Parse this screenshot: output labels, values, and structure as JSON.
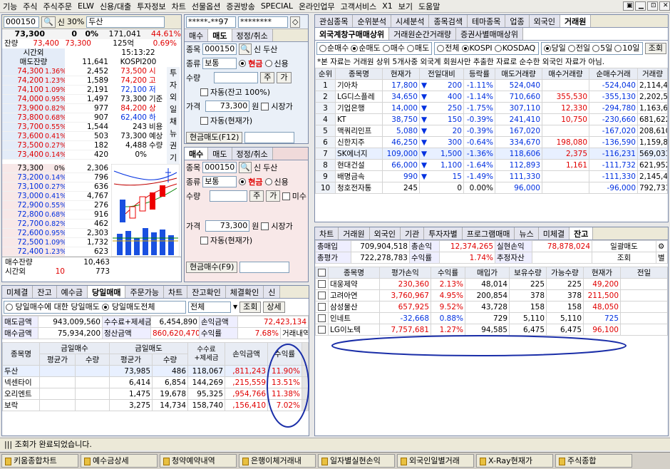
{
  "menu": [
    "기능",
    "주식",
    "주식주문",
    "ELW",
    "신용/대출",
    "투자정보",
    "차트",
    "선물옵션",
    "증권방송",
    "SPECIAL",
    "온라인업무",
    "고객서비스",
    "X1",
    "보기",
    "도움말"
  ],
  "window_buttons": [
    "▣",
    "▁",
    "⊡",
    "✕"
  ],
  "quote": {
    "code": "000150",
    "margin_tag": "신",
    "margin_pct": "30%",
    "name": "두산",
    "price": "73,300",
    "change": "0",
    "change_pct": "0%",
    "volume": "171,041",
    "turnover": "44.61%",
    "label_balance": "잔량",
    "hi1": "73,400",
    "hi2": "73,300",
    "vol_ratio": "125억",
    "pct2": "0.69%",
    "time_label": "시간외",
    "time_label2": "매도잔량",
    "time_val": "11,641",
    "clock": "15:13:22",
    "index_name": "KOSPI200",
    "ask": [
      {
        "price": "74,300",
        "pct": "1.36%",
        "vol": "2,452"
      },
      {
        "price": "74,200",
        "pct": "1.23%",
        "vol": "1,589"
      },
      {
        "price": "74,100",
        "pct": "1.09%",
        "vol": "2,191"
      },
      {
        "price": "74,000",
        "pct": "0.95%",
        "vol": "1,497"
      },
      {
        "price": "73,900",
        "pct": "0.82%",
        "vol": "977"
      },
      {
        "price": "73,800",
        "pct": "0.68%",
        "vol": "907"
      },
      {
        "price": "73,700",
        "pct": "0.55%",
        "vol": "1,544"
      },
      {
        "price": "73,600",
        "pct": "0.41%",
        "vol": "503"
      },
      {
        "price": "73,500",
        "pct": "0.27%",
        "vol": "182"
      },
      {
        "price": "73,400",
        "pct": "0.14%",
        "vol": "420"
      }
    ],
    "bid": [
      {
        "price": "73,300",
        "pct": "0%",
        "vol": "2,306"
      },
      {
        "price": "73,200",
        "pct": "0.14%",
        "vol": "796"
      },
      {
        "price": "73,100",
        "pct": "0.27%",
        "vol": "636"
      },
      {
        "price": "73,000",
        "pct": "0.41%",
        "vol": "4,767"
      },
      {
        "price": "72,900",
        "pct": "0.55%",
        "vol": "276"
      },
      {
        "price": "72,800",
        "pct": "0.68%",
        "vol": "916"
      },
      {
        "price": "72,700",
        "pct": "0.82%",
        "vol": "462"
      },
      {
        "price": "72,600",
        "pct": "0.95%",
        "vol": "2,303"
      },
      {
        "price": "72,500",
        "pct": "1.09%",
        "vol": "1,732"
      },
      {
        "price": "72,400",
        "pct": "1.23%",
        "vol": "623"
      }
    ],
    "info": [
      {
        "v": "73,500",
        "l": "시"
      },
      {
        "v": "74,200",
        "l": "고"
      },
      {
        "v": "72,100",
        "l": "저"
      },
      {
        "v": "73,300",
        "l": "기준"
      },
      {
        "v": "84,200",
        "l": "상"
      },
      {
        "v": "62,400",
        "l": "하"
      },
      {
        "v": "243",
        "l": "비용"
      },
      {
        "v": "73,300",
        "l": "예상"
      },
      {
        "v": "4,488",
        "l": "수량"
      },
      {
        "v": "0%",
        "l": ""
      }
    ],
    "side_letters": [
      "투",
      "자",
      "외",
      "일",
      "채",
      "뉴",
      "권",
      "기"
    ],
    "bid_total_label": "매수잔량",
    "bid_total": "10,463",
    "after_label": "시간외",
    "after_a": "10",
    "after_b": "773"
  },
  "sell_form": {
    "account": "*****-**97",
    "password": "********",
    "tabs": [
      "매수",
      "매도",
      "정정/취소"
    ],
    "label_code": "종목",
    "code": "000150",
    "margin": "신",
    "name": "두산",
    "label_kind": "종류",
    "kind": "보통",
    "cash": "현금",
    "credit": "신용",
    "label_qty": "수량",
    "qty_btn1": "주",
    "qty_btn2": "가",
    "auto_label": "자동(잔고 100%)",
    "label_price": "가격",
    "price": "73,300",
    "won": "원",
    "market": "시장가",
    "auto_price": "자동(현재가)",
    "submit": "현금매도(F12)"
  },
  "buy_form": {
    "tabs": [
      "매수",
      "매도",
      "정정/취소"
    ],
    "label_code": "종목",
    "code": "000150",
    "margin": "신",
    "name": "두산",
    "label_kind": "종류",
    "kind": "보통",
    "cash": "현금",
    "credit": "신용",
    "label_qty": "수량",
    "qty_btn1": "주",
    "qty_btn2": "가",
    "unfilled": "미수",
    "label_price": "가격",
    "price": "73,300",
    "won": "원",
    "market": "시장가",
    "auto_price": "자동(현재가)",
    "submit": "현금매수(F9)"
  },
  "daytrade": {
    "tabs": [
      "미체결",
      "잔고",
      "예수금",
      "당일매매",
      "주문가능",
      "차트",
      "잔고확인",
      "체결확인",
      "신"
    ],
    "active_tab": "당일매매",
    "opt1": "당일매수에 대한 당일매도",
    "opt2": "당일매도전체",
    "filter": "전체",
    "query": "조회",
    "detail": "상세",
    "label_sell_amt": "매도금액",
    "sell_amt": "943,009,560",
    "label_fee": "수수료+제세금",
    "fee": "6,454,890",
    "label_loss": "손익금액",
    "loss": "72,423,134",
    "label_buy_amt": "매수금액",
    "buy_amt": "75,934,200",
    "label_settle": "정산금액",
    "settle": "860,620,470",
    "label_rate": "수익률",
    "rate": "7.68%",
    "history": "거래내역",
    "headers": {
      "name": "종목명",
      "buy": "금일매수",
      "sell": "금일매도",
      "avg": "평균가",
      "qty": "수량",
      "fee": "수수료\n+제세금",
      "pl": "손익금액",
      "rate": "수익률"
    },
    "rows": [
      {
        "name": "두산",
        "buy_avg": "",
        "buy_qty": "",
        "sell_avg": "73,985",
        "sell_qty": "486",
        "fee": "118,067",
        "pl": ",811,243",
        "rate": "11.90%"
      },
      {
        "name": "넥센타이",
        "buy_avg": "",
        "buy_qty": "",
        "sell_avg": "6,414",
        "sell_qty": "6,854",
        "fee": "144,269",
        "pl": ",215,559",
        "rate": "13.51%"
      },
      {
        "name": "오리엔트",
        "buy_avg": "",
        "buy_qty": "",
        "sell_avg": "1,475",
        "sell_qty": "19,678",
        "fee": "95,325",
        "pl": ",954,766",
        "rate": "11.38%"
      },
      {
        "name": "보락",
        "buy_avg": "",
        "buy_qty": "",
        "sell_avg": "3,275",
        "sell_qty": "14,734",
        "fee": "158,740",
        "pl": ",156,410",
        "rate": "7.02%"
      }
    ]
  },
  "foreign": {
    "tabs": [
      "관심종목",
      "순위분석",
      "시세분석",
      "종목검색",
      "테마종목",
      "업종",
      "외국인",
      "거래원"
    ],
    "active_tab": "거래원",
    "subtabs": [
      "외국계창구매매상위",
      "거래원순간거래량",
      "증권사별매매상위"
    ],
    "radios": [
      "순매수",
      "순매도",
      "매수",
      "매도"
    ],
    "mkt": [
      "전체",
      "KOSPI",
      "KOSDAQ"
    ],
    "period": [
      "당일",
      "전일",
      "5일",
      "10일"
    ],
    "query": "조회",
    "notice": "*본 자료는 거래원 상위 5개사중 외국계 회원사만 추출한 자료로 순수한 외국인 자료가 아님.",
    "headers": [
      "순위",
      "종목명",
      "현재가",
      "전일대비",
      "등락률",
      "매도거래량",
      "매수거래량",
      "순매수거래",
      "거래량"
    ],
    "rows": [
      {
        "rank": "1",
        "name": "기아차",
        "price": "17,800",
        "dir": "▼",
        "chg": "200",
        "pct": "-1.11%",
        "sell": "524,040",
        "buy": "",
        "net": "-524,040",
        "vol": "2,114,481"
      },
      {
        "rank": "2",
        "name": "LG디스플레",
        "price": "34,650",
        "dir": "▼",
        "chg": "400",
        "pct": "-1.14%",
        "sell": "710,660",
        "buy": "355,530",
        "net": "-355,130",
        "vol": "2,202,569"
      },
      {
        "rank": "3",
        "name": "기업은행",
        "price": "14,000",
        "dir": "▼",
        "chg": "250",
        "pct": "-1.75%",
        "sell": "307,110",
        "buy": "12,330",
        "net": "-294,780",
        "vol": "1,163,695"
      },
      {
        "rank": "4",
        "name": "KT",
        "price": "38,750",
        "dir": "▼",
        "chg": "150",
        "pct": "-0.39%",
        "sell": "241,410",
        "buy": "10,750",
        "net": "-230,660",
        "vol": "681,622"
      },
      {
        "rank": "5",
        "name": "맥쿼리인프",
        "price": "5,080",
        "dir": "▼",
        "chg": "20",
        "pct": "-0.39%",
        "sell": "167,020",
        "buy": "",
        "net": "-167,020",
        "vol": "208,610"
      },
      {
        "rank": "6",
        "name": "신한지주",
        "price": "46,250",
        "dir": "▼",
        "chg": "300",
        "pct": "-0.64%",
        "sell": "334,670",
        "buy": "198,080",
        "net": "-136,590",
        "vol": "1,159,878"
      },
      {
        "rank": "7",
        "name": "SK에너지",
        "price": "109,000",
        "dir": "▼",
        "chg": "1,500",
        "pct": "-1.36%",
        "sell": "118,606",
        "buy": "2,375",
        "net": "-116,231",
        "vol": "569,033"
      },
      {
        "rank": "8",
        "name": "현대건설",
        "price": "66,000",
        "dir": "▼",
        "chg": "1,100",
        "pct": "-1.64%",
        "sell": "112,893",
        "buy": "1,161",
        "net": "-111,732",
        "vol": "621,952"
      },
      {
        "rank": "9",
        "name": "배명금속",
        "price": "990",
        "dir": "▼",
        "chg": "15",
        "pct": "-1.49%",
        "sell": "111,330",
        "buy": "",
        "net": "-111,330",
        "vol": "2,145,441"
      },
      {
        "rank": "10",
        "name": "청호전자통",
        "price": "245",
        "dir": "",
        "chg": "0",
        "pct": "0.00%",
        "sell": "96,000",
        "buy": "",
        "net": "-96,000",
        "vol": "792,731"
      }
    ]
  },
  "balance": {
    "tabs": [
      "차트",
      "거래원",
      "외국인",
      "기관",
      "투자자별",
      "프로그램매매",
      "뉴스",
      "미체결",
      "잔고"
    ],
    "active_tab": "잔고",
    "label_buy": "총매입",
    "buy": "709,904,518",
    "label_pl": "총손익",
    "pl": "12,374,265",
    "label_real": "실현손익",
    "real": "78,878,024",
    "sell_all": "일괄매도",
    "label_eval": "총평가",
    "eval": "722,278,783",
    "label_rate": "수익률",
    "rate": "1.74%",
    "label_est": "추정자산",
    "est": "",
    "query": "조회",
    "other": "별",
    "headers": [
      "종목명",
      "평가손익",
      "수익률",
      "매입가",
      "보유수량",
      "가능수량",
      "현재가",
      "전일"
    ],
    "rows": [
      {
        "name": "대웅제약",
        "pl": "230,360",
        "rate": "2.13%",
        "avg": "48,014",
        "hold": "225",
        "avail": "225",
        "price": "49,200",
        "pl_c": "red",
        "price_c": "red"
      },
      {
        "name": "고려아연",
        "pl": "3,760,967",
        "rate": "4.95%",
        "avg": "200,854",
        "hold": "378",
        "avail": "378",
        "price": "211,500",
        "pl_c": "red",
        "price_c": "red"
      },
      {
        "name": "삼성물산",
        "pl": "657,925",
        "rate": "9.52%",
        "avg": "43,728",
        "hold": "158",
        "avail": "158",
        "price": "48,050",
        "pl_c": "red",
        "price_c": "red"
      },
      {
        "name": "인네트",
        "pl": "-32,668",
        "rate": "0.88%",
        "avg": "729",
        "hold": "5,110",
        "avail": "5,110",
        "price": "725",
        "pl_c": "blue",
        "price_c": "blue"
      },
      {
        "name": "LG이노텍",
        "pl": "7,757,681",
        "rate": "1.27%",
        "avg": "94,585",
        "hold": "6,475",
        "avail": "6,475",
        "price": "96,100",
        "pl_c": "red",
        "price_c": "red"
      }
    ]
  },
  "status": {
    "message": "조회가 완료되었습니다."
  },
  "taskbar": [
    "키움종합차트",
    "예수금상세",
    "청약예약내역",
    "은행이체거래내",
    "일자별실현손익",
    "외국인일별거래",
    "X-Ray현재가",
    "주식종합"
  ],
  "colors": {
    "up": "#e00000",
    "down": "#0030e0",
    "panel_border": "#7b8aa8",
    "annotation": "#1a2ea8"
  }
}
